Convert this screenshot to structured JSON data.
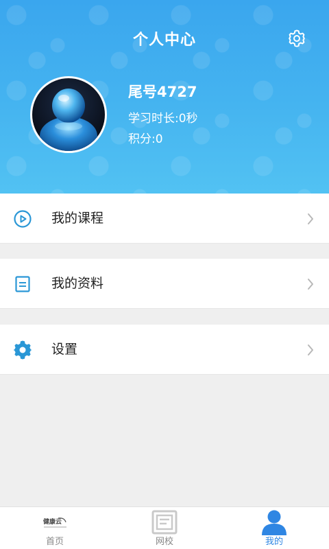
{
  "header": {
    "title": "个人中心",
    "settings_icon": "gear-icon"
  },
  "profile": {
    "name": "尾号4727",
    "study_time": "学习时长:0秒",
    "points": "积分:0"
  },
  "menu": [
    {
      "label": "我的课程",
      "icon": "play-circle-icon"
    },
    {
      "label": "我的资料",
      "icon": "document-icon"
    },
    {
      "label": "设置",
      "icon": "gear-icon"
    }
  ],
  "bottom_nav": [
    {
      "label": "首页",
      "logo_text": "健康云",
      "active": false
    },
    {
      "label": "网校",
      "active": false
    },
    {
      "label": "我的",
      "active": true
    }
  ],
  "colors": {
    "accent": "#2f86e3",
    "header_gradient_top": "#3aa6ee",
    "header_gradient_bottom": "#52c2f3",
    "menu_icon": "#2a97d6"
  }
}
